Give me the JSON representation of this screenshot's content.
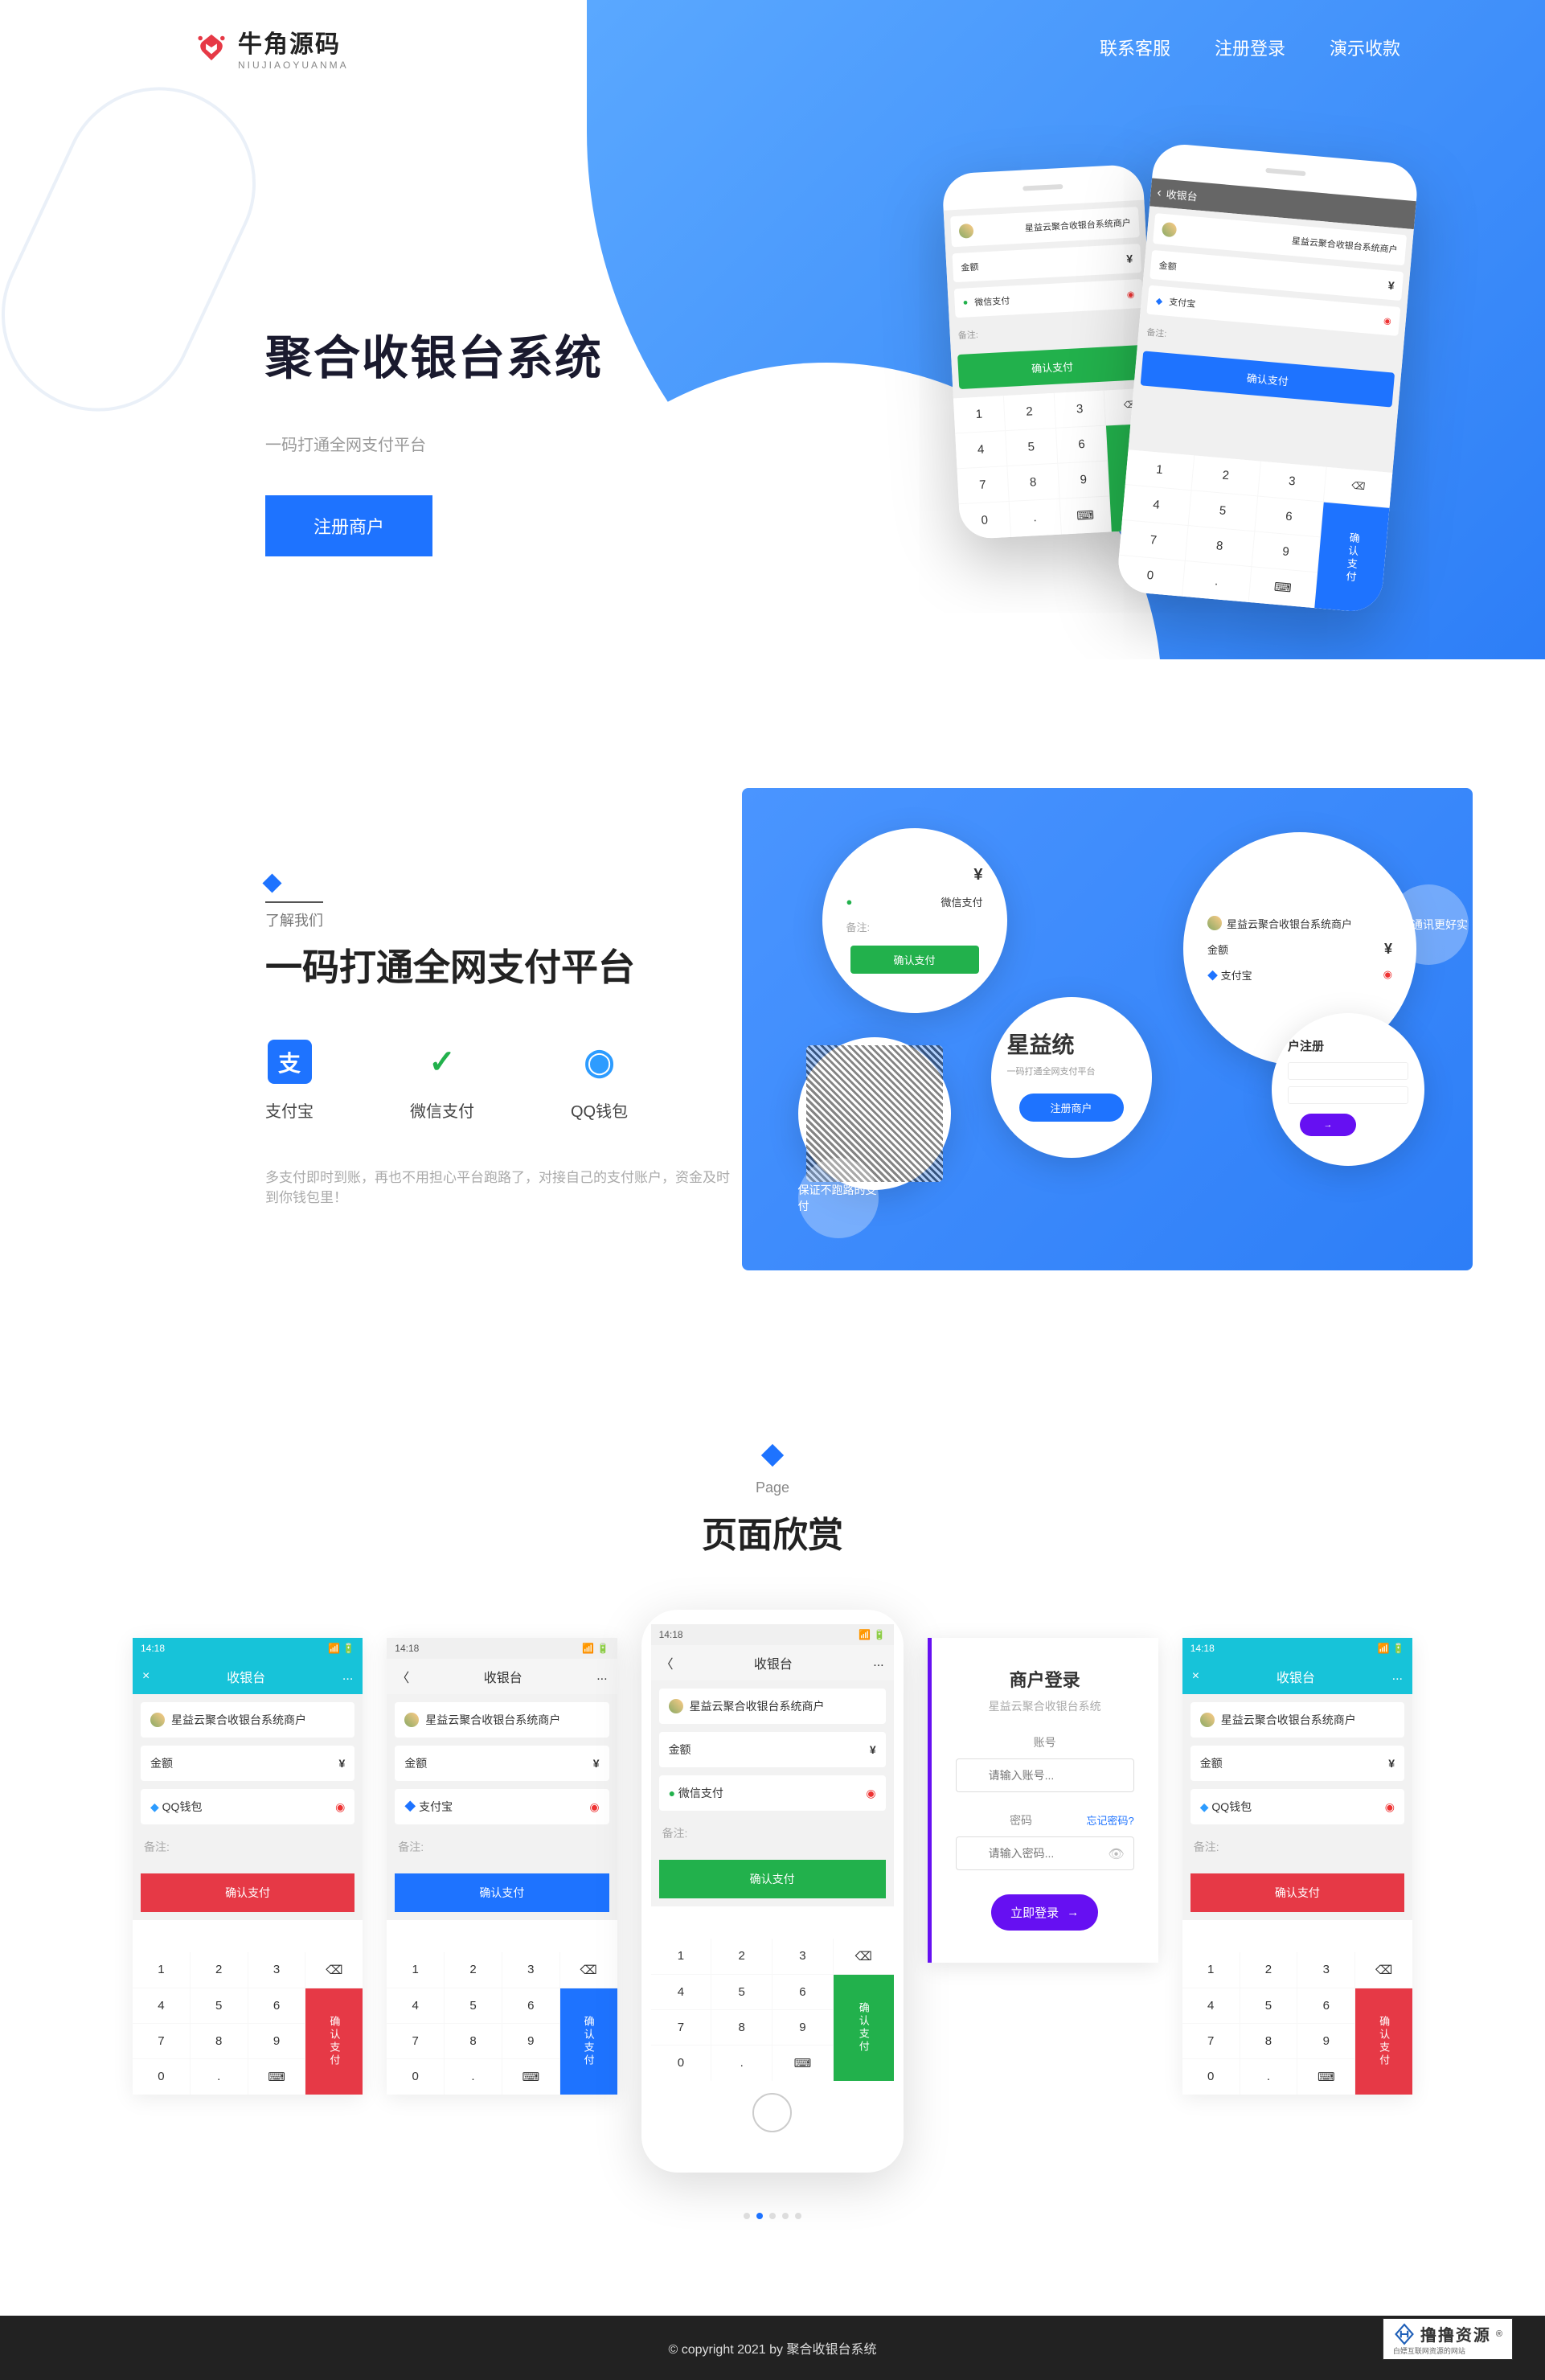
{
  "nav": {
    "brand": "牛角源码",
    "brand_sub": "NIUJIAOYUANMA",
    "links": [
      "联系客服",
      "注册登录",
      "演示收款"
    ]
  },
  "hero": {
    "title": "聚合收银台系统",
    "subtitle": "一码打通全网支付平台",
    "button": "注册商户"
  },
  "phone_demo": {
    "header_title": "收银台",
    "merchant": "星益云聚合收银台系统商户",
    "amount_label": "金额",
    "currency": "¥",
    "alipay": "支付宝",
    "wechat": "微信支付",
    "remark": "备注:",
    "confirm": "确认支付",
    "keypad_confirm": "确认支付"
  },
  "section2": {
    "pretitle": "了解我们",
    "title": "一码打通全网支付平台",
    "methods": [
      {
        "icon": "支",
        "label": "支付宝",
        "color": "#1e73ff"
      },
      {
        "icon": "✓",
        "label": "微信支付",
        "color": "#22b14c"
      },
      {
        "icon": "◉",
        "label": "QQ钱包",
        "color": "#2d9cff"
      }
    ],
    "desc": "多支付即时到账，再也不用担心平台跑路了，对接自己的支付账户，资金及时到你钱包里！",
    "bubbles": {
      "merchant": "星益云聚合收银台系统商户",
      "amount": "金额",
      "wechat": "微信支付",
      "remark": "备注:",
      "confirm_green": "确认支付",
      "alipay": "支付宝",
      "sys_title": "星益统",
      "sys_sub": "一码打通全网支付平台",
      "register_btn": "注册商户",
      "login_title": "户注册",
      "side1": "梦想通讯更好实",
      "side2": "保证不跑路的支付"
    }
  },
  "section3": {
    "pretitle": "Page",
    "title": "页面欣赏"
  },
  "shots": {
    "time": "14:18",
    "header": "收银台",
    "close": "×",
    "menu": "...",
    "back": "〈",
    "merchant": "星益云聚合收银台系统商户",
    "amount_label": "金额",
    "currency": "¥",
    "qq": "QQ钱包",
    "alipay": "支付宝",
    "wechat": "微信支付",
    "remark": "备注:",
    "confirm": "确认支付",
    "kp_confirm": "确认支付",
    "keys": [
      "1",
      "2",
      "3",
      "⌫",
      "4",
      "5",
      "6",
      "7",
      "8",
      "9",
      "0",
      ".",
      "⌨"
    ]
  },
  "login": {
    "title": "商户登录",
    "subtitle": "星益云聚合收银台系统",
    "account_label": "账号",
    "account_placeholder": "请输入账号...",
    "password_label": "密码",
    "password_placeholder": "请输入密码...",
    "forgot": "忘记密码?",
    "button": "立即登录",
    "arrow": "→"
  },
  "footer": {
    "copyright": "© copyright 2021 by 聚合收银台系统"
  },
  "watermark": {
    "title": "撸撸资源",
    "reg": "®",
    "sub": "白嫖互联网资源的网站"
  }
}
